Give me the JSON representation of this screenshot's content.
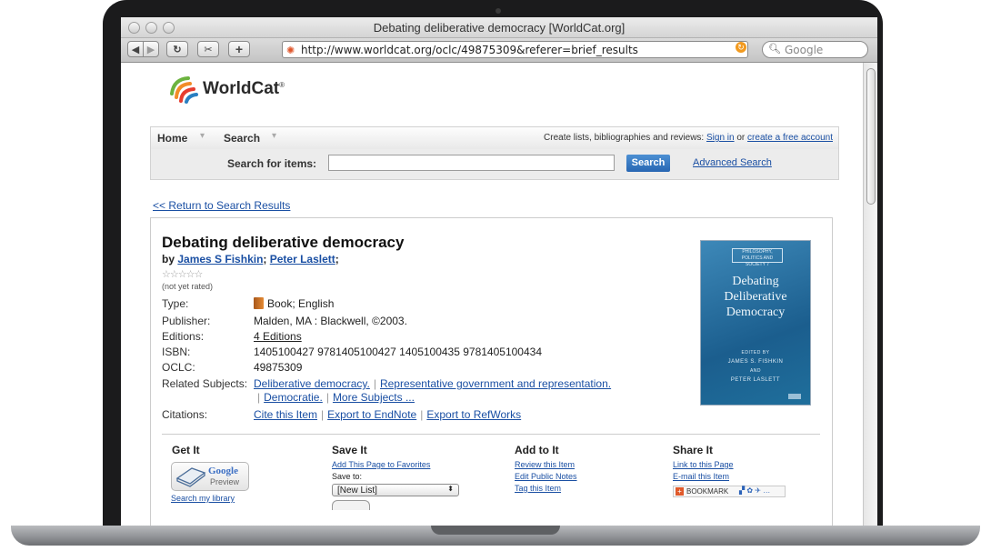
{
  "browser": {
    "window_title": "Debating deliberative democracy [WorldCat.org]",
    "url": "http://www.worldcat.org/oclc/49875309&referer=brief_results",
    "search_placeholder": "Google"
  },
  "site": {
    "logo_text": "WorldCat",
    "logo_mark": "®",
    "nav": {
      "home": "Home",
      "search": "Search",
      "promo_text": "Create lists, bibliographies and reviews:",
      "sign_in": "Sign in",
      "or": "or",
      "create_account": "create a free account"
    },
    "search": {
      "label": "Search for items:",
      "button": "Search",
      "advanced": "Advanced Search"
    },
    "return_link": "<< Return to Search Results"
  },
  "record": {
    "title": "Debating deliberative democracy",
    "by": "by",
    "author1": "James S Fishkin",
    "author2": "Peter Laslett",
    "stars": "☆☆☆☆☆",
    "rating_note": "(not yet rated)",
    "fields": {
      "type_label": "Type:",
      "type_value": "Book; English",
      "publisher_label": "Publisher:",
      "publisher_value": "Malden, MA : Blackwell, ©2003.",
      "editions_label": "Editions:",
      "editions_value": "4 Editions",
      "isbn_label": "ISBN:",
      "isbn_value": "1405100427 9781405100427 1405100435 9781405100434",
      "oclc_label": "OCLC:",
      "oclc_value": "49875309",
      "subjects_label": "Related Subjects:",
      "subject1": "Deliberative democracy.",
      "subject2": "Representative government and representation.",
      "subject3": "Democratie.",
      "more_subjects": "More Subjects ...",
      "citations_label": "Citations:",
      "cite": "Cite this Item",
      "endnote": "Export to EndNote",
      "refworks": "Export to RefWorks"
    },
    "cover": {
      "series": "PHILOSOPHY, POLITICS AND SOCIETY 7",
      "title_line1": "Debating",
      "title_line2": "Deliberative",
      "title_line3": "Democracy",
      "edited_by": "EDITED BY",
      "editor1": "JAMES S. FISHKIN",
      "and": "AND",
      "editor2": "PETER LASLETT"
    }
  },
  "actions": {
    "get_it": {
      "heading": "Get It",
      "preview_brand": "Google",
      "preview_text": "Preview",
      "search_library": "Search my library"
    },
    "save_it": {
      "heading": "Save It",
      "add_favorites": "Add This Page to Favorites",
      "save_to": "Save to:",
      "list_value": "[New List]"
    },
    "add_to_it": {
      "heading": "Add to It",
      "review": "Review this Item",
      "notes": "Edit Public Notes",
      "tag": "Tag this Item"
    },
    "share_it": {
      "heading": "Share It",
      "link": "Link to this Page",
      "email": "E-mail this Item",
      "bookmark": "BOOKMARK"
    }
  }
}
